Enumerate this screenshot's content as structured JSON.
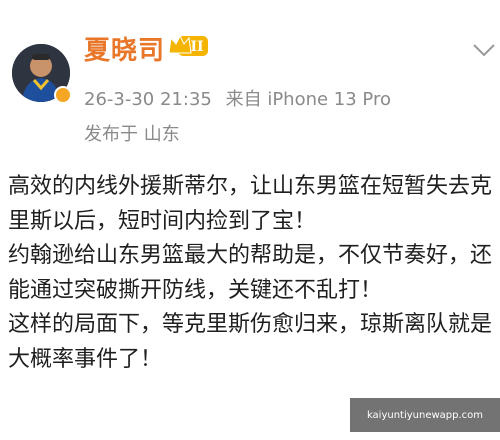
{
  "post": {
    "author": "夏晓司",
    "badge_level": "II",
    "timestamp": "26-3-30 21:35",
    "device": "来自 iPhone 13 Pro",
    "location": "发布于 山东",
    "body_lines": [
      "高效的内线外援斯蒂尔，让山东男篮在短暂失去克",
      "里斯以后，短时间内捡到了宝！",
      "约翰逊给山东男篮最大的帮助是，不仅节奏好，还",
      "能通过突破撕开防线，关键还不乱打！",
      "这样的局面下，等克里斯伤愈归来，琼斯离队就是",
      "大概率事件了！"
    ]
  },
  "watermark": {
    "url": "kaiyuntiyunewapp.com"
  },
  "icons": {
    "avatar": "avatar-basketball-player",
    "verify": "verified-badge-icon",
    "vip": "crown-vip-badge-icon",
    "menu": "chevron-down-icon"
  },
  "colors": {
    "username": "#e8772a",
    "meta": "#8a8a8a",
    "badge_gold": "#f5a623"
  }
}
